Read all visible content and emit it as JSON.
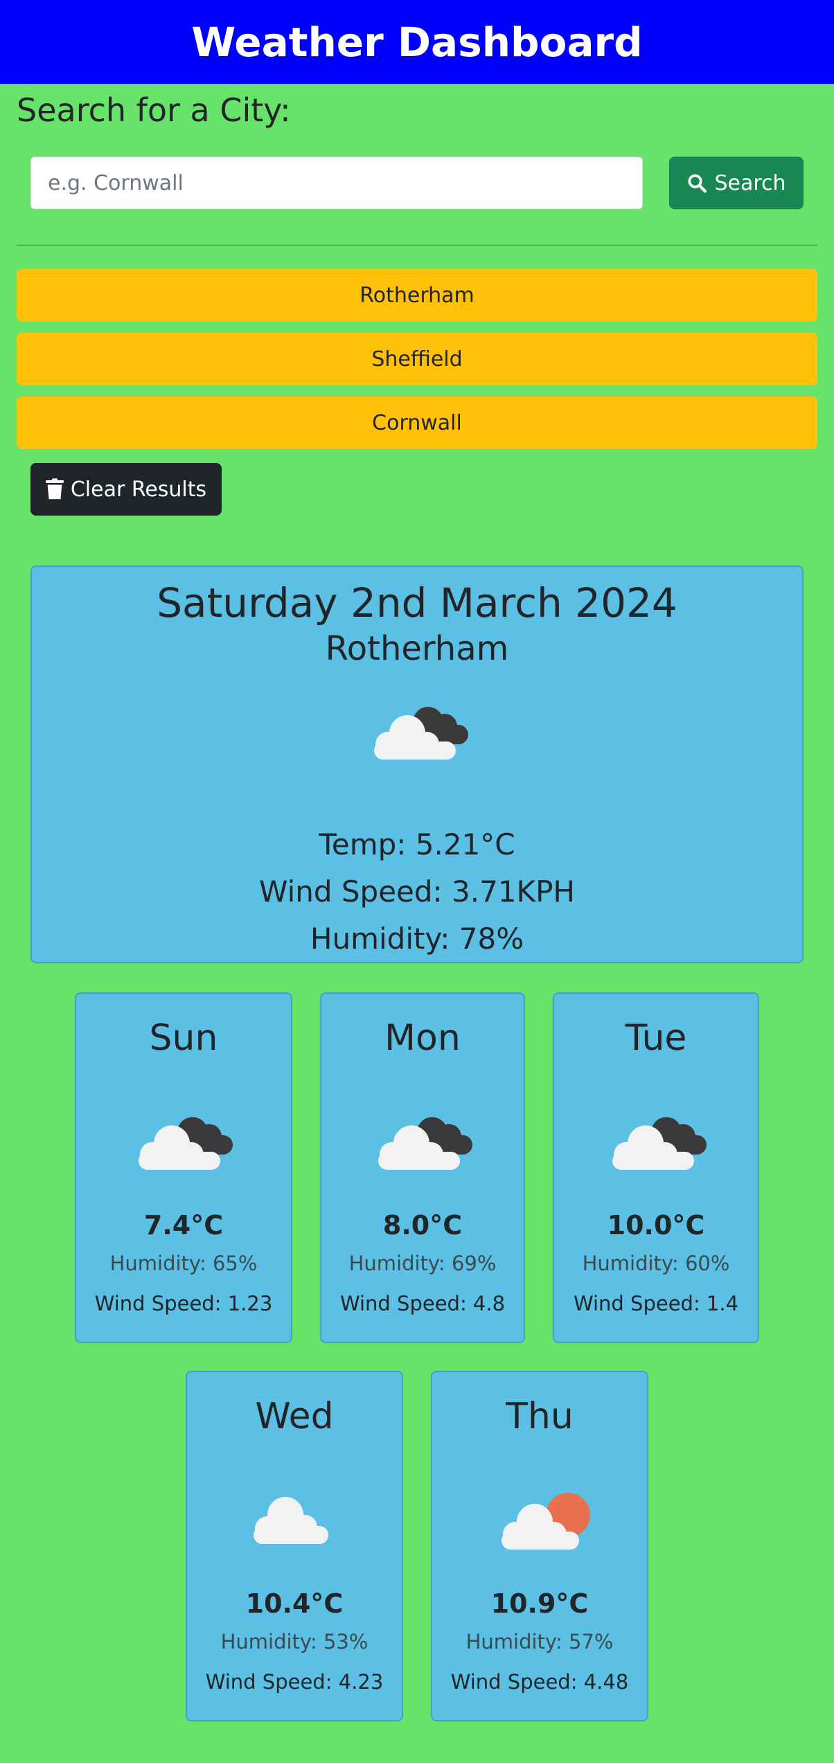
{
  "header": {
    "title": "Weather Dashboard"
  },
  "search": {
    "heading": "Search for a City:",
    "placeholder": "e.g. Cornwall",
    "button_label": "Search"
  },
  "history": [
    "Rotherham",
    "Sheffield",
    "Cornwall"
  ],
  "clear_label": "Clear Results",
  "current": {
    "date": "Saturday 2nd March 2024",
    "city": "Rotherham",
    "icon": "broken-clouds-icon",
    "temp": "Temp: 5.21°C",
    "wind": "Wind Speed: 3.71KPH",
    "humidity": "Humidity: 78%"
  },
  "forecast": [
    {
      "day": "Sun",
      "icon": "broken-clouds-icon",
      "temp": "7.4°C",
      "humidity": "Humidity: 65%",
      "wind": "Wind Speed: 1.23"
    },
    {
      "day": "Mon",
      "icon": "broken-clouds-icon",
      "temp": "8.0°C",
      "humidity": "Humidity: 69%",
      "wind": "Wind Speed: 4.8"
    },
    {
      "day": "Tue",
      "icon": "broken-clouds-icon",
      "temp": "10.0°C",
      "humidity": "Humidity: 60%",
      "wind": "Wind Speed: 1.4"
    },
    {
      "day": "Wed",
      "icon": "cloud-icon",
      "temp": "10.4°C",
      "humidity": "Humidity: 53%",
      "wind": "Wind Speed: 4.23"
    },
    {
      "day": "Thu",
      "icon": "partly-sunny-icon",
      "temp": "10.9°C",
      "humidity": "Humidity: 57%",
      "wind": "Wind Speed: 4.48"
    }
  ],
  "colors": {
    "header_bg": "#0000ff",
    "page_bg": "#68e36a",
    "search_button": "#198754",
    "history_button": "#ffc107",
    "clear_button": "#212529",
    "card_bg": "#5bc0e3"
  }
}
